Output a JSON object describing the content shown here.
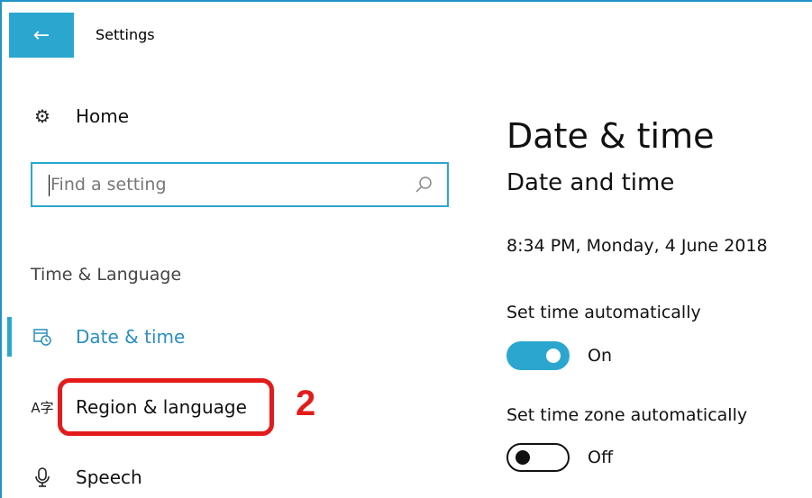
{
  "window": {
    "title": "Settings",
    "back_icon": "arrow-left-icon"
  },
  "sidebar": {
    "home": {
      "label": "Home",
      "icon": "gear-icon"
    },
    "search": {
      "placeholder": "Find a setting",
      "icon": "search-icon"
    },
    "section_label": "Time & Language",
    "items": [
      {
        "label": "Date & time",
        "icon": "calendar-clock-icon",
        "selected": true
      },
      {
        "label": "Region & language",
        "icon": "language-icon",
        "selected": false
      },
      {
        "label": "Speech",
        "icon": "microphone-icon",
        "selected": false
      }
    ]
  },
  "annotation": {
    "step_number": "2",
    "color": "#e41b1b"
  },
  "main": {
    "title": "Date & time",
    "section_title": "Date and time",
    "current_datetime": "8:34 PM, Monday, 4 June 2018",
    "set_time_auto": {
      "label": "Set time automatically",
      "state": "On",
      "on": true
    },
    "set_timezone_auto": {
      "label": "Set time zone automatically",
      "state": "Off",
      "on": false
    }
  },
  "colors": {
    "accent": "#2ba7cf",
    "selected_text": "#2b8fc0"
  }
}
